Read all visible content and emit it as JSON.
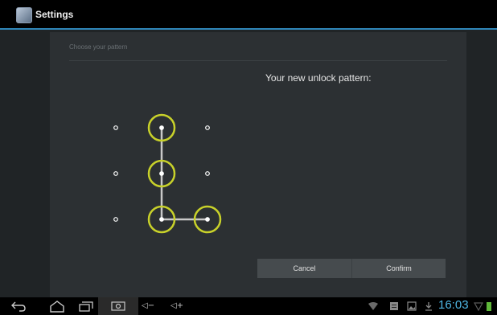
{
  "titlebar": {
    "title": "Settings",
    "icon": "settings-app-icon"
  },
  "panel": {
    "header": "Choose your pattern",
    "heading": "Your new unlock pattern:"
  },
  "pattern": {
    "grid_size": 3,
    "selected_dots": [
      1,
      4,
      7,
      8
    ],
    "accent_color": "#c8d12a",
    "line_color": "#c9c9c9"
  },
  "buttons": {
    "cancel": "Cancel",
    "confirm": "Confirm"
  },
  "navbar": {
    "back_icon": "back-icon",
    "home_icon": "home-icon",
    "recents_icon": "recent-apps-icon",
    "screenshot_icon": "screenshot-icon",
    "volume_down_label": "◁−",
    "volume_up_label": "◁+"
  },
  "status": {
    "time": "16:03",
    "icons": [
      "wifi-icon",
      "notification-icon",
      "image-icon",
      "download-icon",
      "signal-icon",
      "battery-icon"
    ],
    "clock_color": "#4fb8e6"
  }
}
